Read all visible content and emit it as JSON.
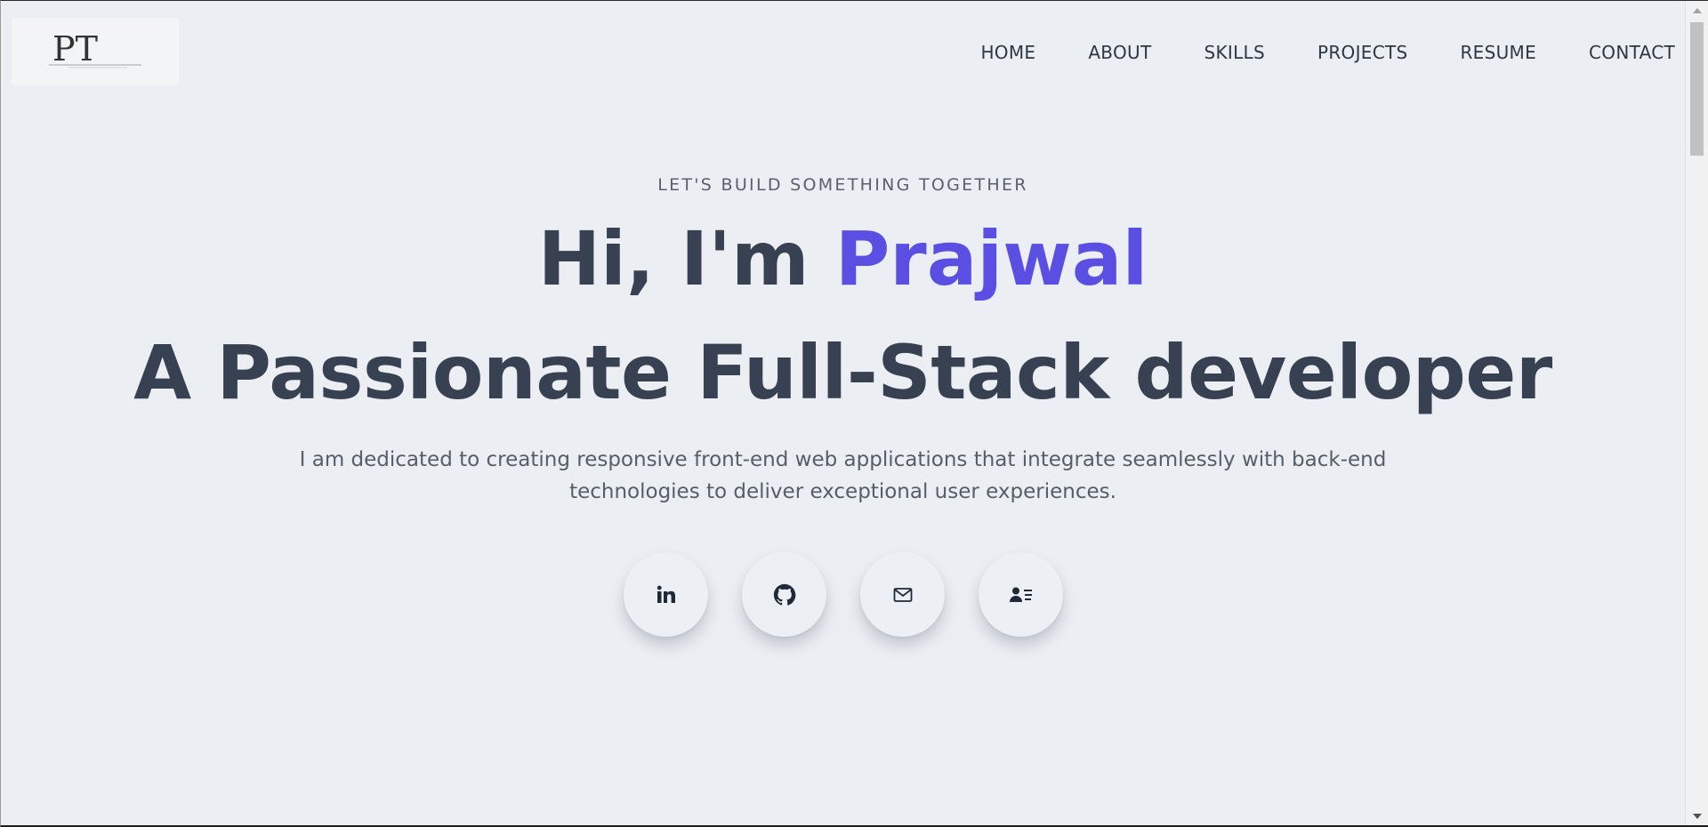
{
  "logo": {
    "text": "PT"
  },
  "nav": {
    "items": [
      {
        "label": "HOME"
      },
      {
        "label": "ABOUT"
      },
      {
        "label": "SKILLS"
      },
      {
        "label": "PROJECTS"
      },
      {
        "label": "RESUME"
      },
      {
        "label": "CONTACT"
      }
    ]
  },
  "hero": {
    "eyebrow": "LET'S BUILD SOMETHING TOGETHER",
    "greeting": "Hi, I'm ",
    "name": "Prajwal",
    "tagline": "A Passionate Full-Stack developer",
    "description": "I am dedicated to creating responsive front-end web applications that integrate seamlessly with back-end technologies to deliver exceptional user experiences."
  },
  "socials": [
    {
      "name": "linkedin",
      "icon": "linkedin-icon"
    },
    {
      "name": "github",
      "icon": "github-icon"
    },
    {
      "name": "email",
      "icon": "mail-icon"
    },
    {
      "name": "resume",
      "icon": "contact-card-icon"
    }
  ],
  "colors": {
    "background": "#ebeef2",
    "heading": "#374151",
    "accent": "#5b4fe3",
    "body_text": "#575d69"
  }
}
